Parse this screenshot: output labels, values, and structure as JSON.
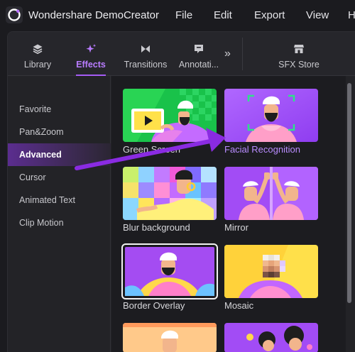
{
  "app": {
    "title": "Wondershare DemoCreator"
  },
  "menu": [
    {
      "label": "File"
    },
    {
      "label": "Edit"
    },
    {
      "label": "Export"
    },
    {
      "label": "View"
    },
    {
      "label": "H"
    }
  ],
  "tabs": [
    {
      "label": "Library",
      "icon": "layers-icon"
    },
    {
      "label": "Effects",
      "icon": "sparkle-icon",
      "active": true
    },
    {
      "label": "Transitions",
      "icon": "bowtie-icon"
    },
    {
      "label": "Annotati...",
      "icon": "annotation-icon"
    },
    {
      "label": "SFX Store",
      "icon": "store-icon"
    }
  ],
  "more_label": "»",
  "sidebar": {
    "items": [
      {
        "label": "Favorite"
      },
      {
        "label": "Pan&Zoom"
      },
      {
        "label": "Advanced",
        "active": true
      },
      {
        "label": "Cursor"
      },
      {
        "label": "Animated Text"
      },
      {
        "label": "Clip Motion"
      }
    ]
  },
  "effects": [
    {
      "label": "Green Screen"
    },
    {
      "label": "Facial Recognition",
      "highlighted": true
    },
    {
      "label": "Blur background"
    },
    {
      "label": "Mirror"
    },
    {
      "label": "Border Overlay",
      "selected": true
    },
    {
      "label": "Mosaic"
    }
  ],
  "colors": {
    "accent": "#a55cf5",
    "arrow": "#8a2be2",
    "background": "#1b1b1f"
  }
}
